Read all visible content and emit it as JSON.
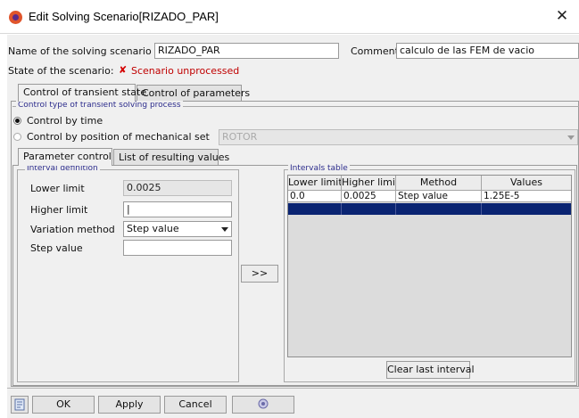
{
  "window": {
    "title": "Edit Solving Scenario[RIZADO_PAR]",
    "close_glyph": "✕"
  },
  "header": {
    "name_label": "Name of the solving scenario *",
    "name_value": "RIZADO_PAR",
    "comment_label": "Comment",
    "comment_value": "calculo de las FEM de vacio",
    "state_label": "State of the scenario:",
    "state_mark": "✘",
    "state_value": "Scenario unprocessed"
  },
  "tabs": [
    {
      "label": "Control of transient state",
      "active": true
    },
    {
      "label": "Control of parameters",
      "active": false
    }
  ],
  "control_type": {
    "group_title": "Control type of transient solving process",
    "options": [
      {
        "label": "Control by time",
        "selected": true
      },
      {
        "label": "Control by position of mechanical set",
        "selected": false
      }
    ],
    "mechanical_set_value": "ROTOR"
  },
  "subtabs": [
    {
      "label": "Parameter control",
      "active": true
    },
    {
      "label": "List of resulting values",
      "active": false
    }
  ],
  "interval_definition": {
    "group_title": "Interval definition",
    "lower_limit_label": "Lower limit",
    "lower_limit_value": "0.0025",
    "higher_limit_label": "Higher limit",
    "higher_limit_value": "|",
    "variation_label": "Variation method",
    "variation_value": "Step value",
    "step_label": "Step value",
    "step_value": ""
  },
  "transfer_button": ">>",
  "intervals_table": {
    "group_title": "Intervals table",
    "columns": [
      "Lower limit",
      "Higher limit",
      "Method",
      "Values"
    ],
    "rows": [
      [
        "0.0",
        "0.0025",
        "Step value",
        "1.25E-5"
      ]
    ],
    "clear_button": "Clear last interval"
  },
  "footer": {
    "ok": "OK",
    "apply": "Apply",
    "cancel": "Cancel",
    "help_icon": "help-icon",
    "doc_icon": "document-icon"
  }
}
